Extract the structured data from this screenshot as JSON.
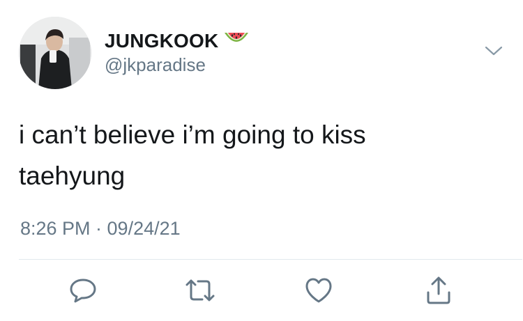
{
  "tweet": {
    "display_name": "JUNGKOOK",
    "handle": "@jkparadise",
    "text_line1": "i can’t believe i’m going to kiss",
    "text_line2": "taehyung",
    "timestamp": "8:26 PM · 09/24/21"
  },
  "icons": {
    "name_emoji": "watermelon-icon",
    "menu": "chevron-down-icon",
    "reply": "reply-icon",
    "retweet": "retweet-icon",
    "like": "heart-icon",
    "share": "share-icon"
  },
  "colors": {
    "text": "#14171a",
    "secondary": "#657786",
    "divider": "#e1e8ed",
    "icon": "#657786"
  }
}
